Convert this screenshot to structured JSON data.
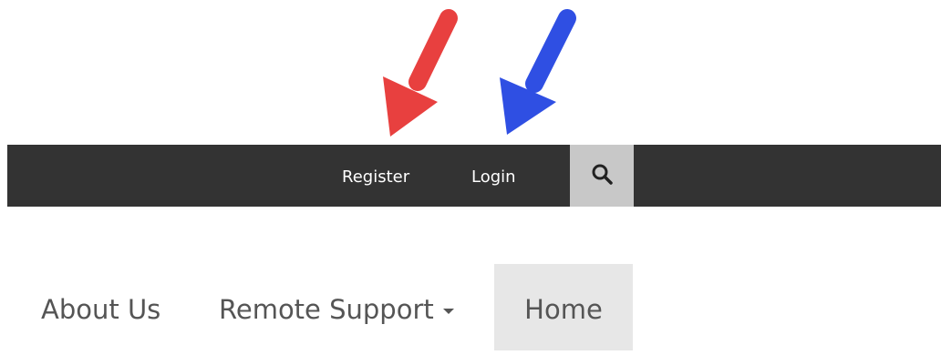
{
  "annotations": {
    "arrows": [
      {
        "name": "red-arrow-icon",
        "color": "#e8403f",
        "points_to": "register"
      },
      {
        "name": "blue-arrow-icon",
        "color": "#2f4fe3",
        "points_to": "login"
      }
    ]
  },
  "top_bar": {
    "background": "#333333",
    "register_label": "Register",
    "login_label": "Login",
    "search_icon": "search-icon"
  },
  "main_nav": {
    "items": [
      {
        "label": "About Us"
      },
      {
        "label": "Remote Support",
        "icon": "caret-down-icon"
      },
      {
        "label": "Home",
        "active": true
      }
    ]
  }
}
